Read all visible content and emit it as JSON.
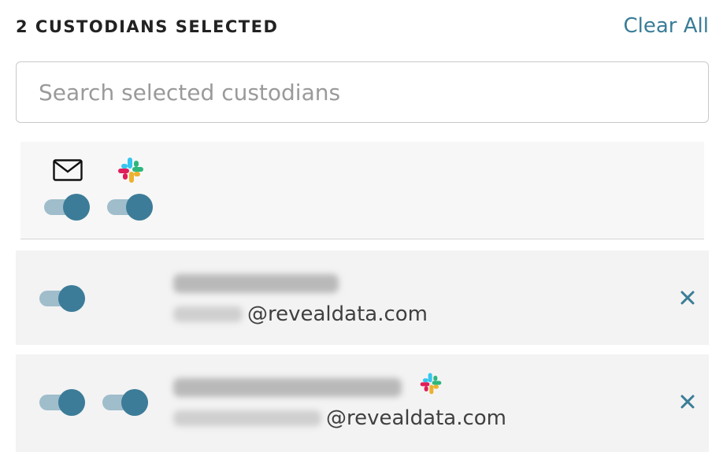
{
  "header": {
    "title": "2 CUSTODIANS SELECTED",
    "clear_all": "Clear All"
  },
  "search": {
    "placeholder": "Search selected custodians",
    "value": ""
  },
  "channels": [
    {
      "icon": "mail-icon",
      "enabled": true
    },
    {
      "icon": "slack-icon",
      "enabled": true
    }
  ],
  "custodians": [
    {
      "email_domain": "@revealdata.com",
      "email_enabled": true,
      "slack_enabled": false,
      "has_slack": false
    },
    {
      "email_domain": "@revealdata.com",
      "email_enabled": true,
      "slack_enabled": true,
      "has_slack": true
    }
  ],
  "colors": {
    "accent": "#3a7d97",
    "toggle_knob": "#3c7c98",
    "toggle_track": "#9fbdcb",
    "row_bg": "#f3f3f3",
    "slack_blue": "#36C5F0",
    "slack_green": "#2EB67D",
    "slack_red": "#E01E5A",
    "slack_yellow": "#ECB22E"
  }
}
